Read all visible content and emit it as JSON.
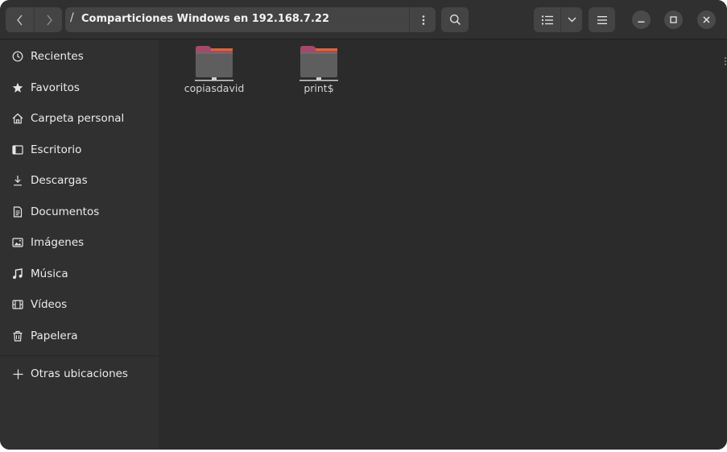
{
  "header": {
    "path_separator": "/",
    "path_title": "Comparticiones Windows en 192.168.7.22"
  },
  "sidebar": {
    "items": [
      {
        "label": "Recientes",
        "icon": "clock-icon"
      },
      {
        "label": "Favoritos",
        "icon": "star-icon"
      },
      {
        "label": "Carpeta personal",
        "icon": "home-icon"
      },
      {
        "label": "Escritorio",
        "icon": "desktop-icon"
      },
      {
        "label": "Descargas",
        "icon": "download-icon"
      },
      {
        "label": "Documentos",
        "icon": "document-icon"
      },
      {
        "label": "Imágenes",
        "icon": "image-icon"
      },
      {
        "label": "Música",
        "icon": "music-icon"
      },
      {
        "label": "Vídeos",
        "icon": "video-icon"
      },
      {
        "label": "Papelera",
        "icon": "trash-icon"
      }
    ],
    "other_locations": {
      "label": "Otras ubicaciones",
      "icon": "plus-icon"
    }
  },
  "files": [
    {
      "name": "copiasdavid",
      "icon": "network-folder-icon"
    },
    {
      "name": "print$",
      "icon": "network-folder-icon"
    }
  ],
  "colors": {
    "window_bg": "#2b2b2b",
    "sidebar_bg": "#303030",
    "folder_tab": "#a34a6b",
    "folder_body": "#5e5e5e",
    "folder_accent": "#e2643a"
  }
}
